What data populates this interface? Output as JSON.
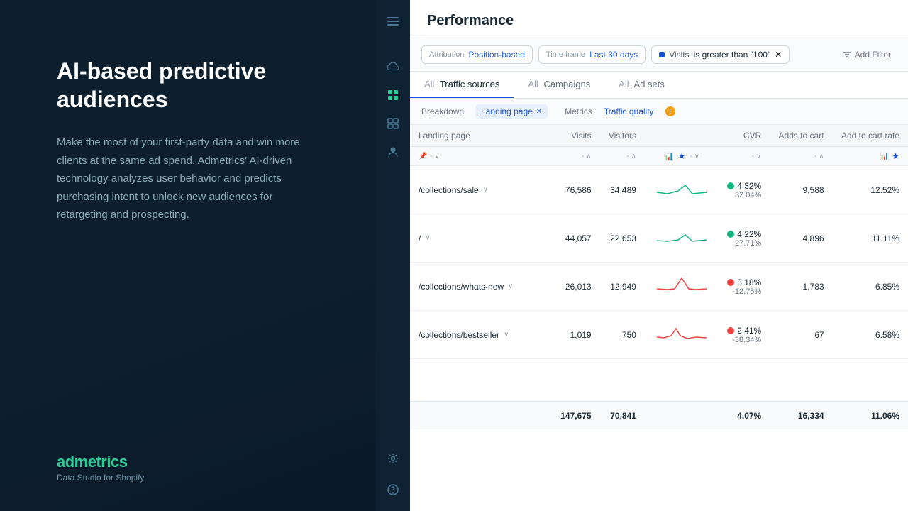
{
  "left": {
    "heading": "AI-based predictive audiences",
    "description": "Make the most of your first-party data and win more clients at the same ad spend. Admetrics' AI-driven technology analyzes user behavior and predicts purchasing intent to unlock new audiences for retargeting and prospecting.",
    "brand_name": "admetrics",
    "brand_tagline": "Data Studio for Shopify"
  },
  "panel": {
    "title": "Performance",
    "filters": {
      "attribution_label": "Attribution",
      "attribution_value": "Position-based",
      "timeframe_label": "Time frame",
      "timeframe_value": "Last 30 days",
      "visits_label": "Visits",
      "visits_value": "is greater than \"100\"",
      "add_filter_label": "Add Filter"
    },
    "tabs": [
      {
        "label": "All Traffic sources",
        "prefix": "All",
        "active": true
      },
      {
        "label": "All Campaigns",
        "prefix": "All",
        "active": false
      },
      {
        "label": "All Ad sets",
        "prefix": "All",
        "active": false
      }
    ],
    "breakdown_label": "Breakdown",
    "breakdown_chip": "Landing page",
    "metrics_label": "Metrics",
    "metrics_value": "Traffic quality",
    "columns": [
      "Landing page",
      "Visits",
      "Visitors",
      "",
      "CVR",
      "Adds to cart",
      "Add to cart rate"
    ],
    "rows": [
      {
        "landing_page": "/collections/sale",
        "visits": "76,586",
        "visitors": "34,489",
        "cvr_main": "4.32%",
        "cvr_sub": "32.04%",
        "cvr_positive": true,
        "adds_to_cart": "9,588",
        "add_to_cart_rate": "12.52%",
        "sparkline_color": "green"
      },
      {
        "landing_page": "/",
        "visits": "44,057",
        "visitors": "22,653",
        "cvr_main": "4.22%",
        "cvr_sub": "27.71%",
        "cvr_positive": true,
        "adds_to_cart": "4,896",
        "add_to_cart_rate": "11.11%",
        "sparkline_color": "green"
      },
      {
        "landing_page": "/collections/whats-new",
        "visits": "26,013",
        "visitors": "12,949",
        "cvr_main": "3.18%",
        "cvr_sub": "-12.75%",
        "cvr_positive": false,
        "adds_to_cart": "1,783",
        "add_to_cart_rate": "6.85%",
        "sparkline_color": "red"
      },
      {
        "landing_page": "/collections/bestseller",
        "visits": "1,019",
        "visitors": "750",
        "cvr_main": "2.41%",
        "cvr_sub": "-38.34%",
        "cvr_positive": false,
        "adds_to_cart": "67",
        "add_to_cart_rate": "6.58%",
        "sparkline_color": "red"
      }
    ],
    "footer": {
      "visits": "147,675",
      "visitors": "70,841",
      "cvr": "4.07%",
      "adds_to_cart": "16,334",
      "add_to_cart_rate": "11.06%"
    }
  },
  "nav_icons": [
    "≡",
    "⬡",
    "▦",
    "◫",
    "♟"
  ]
}
